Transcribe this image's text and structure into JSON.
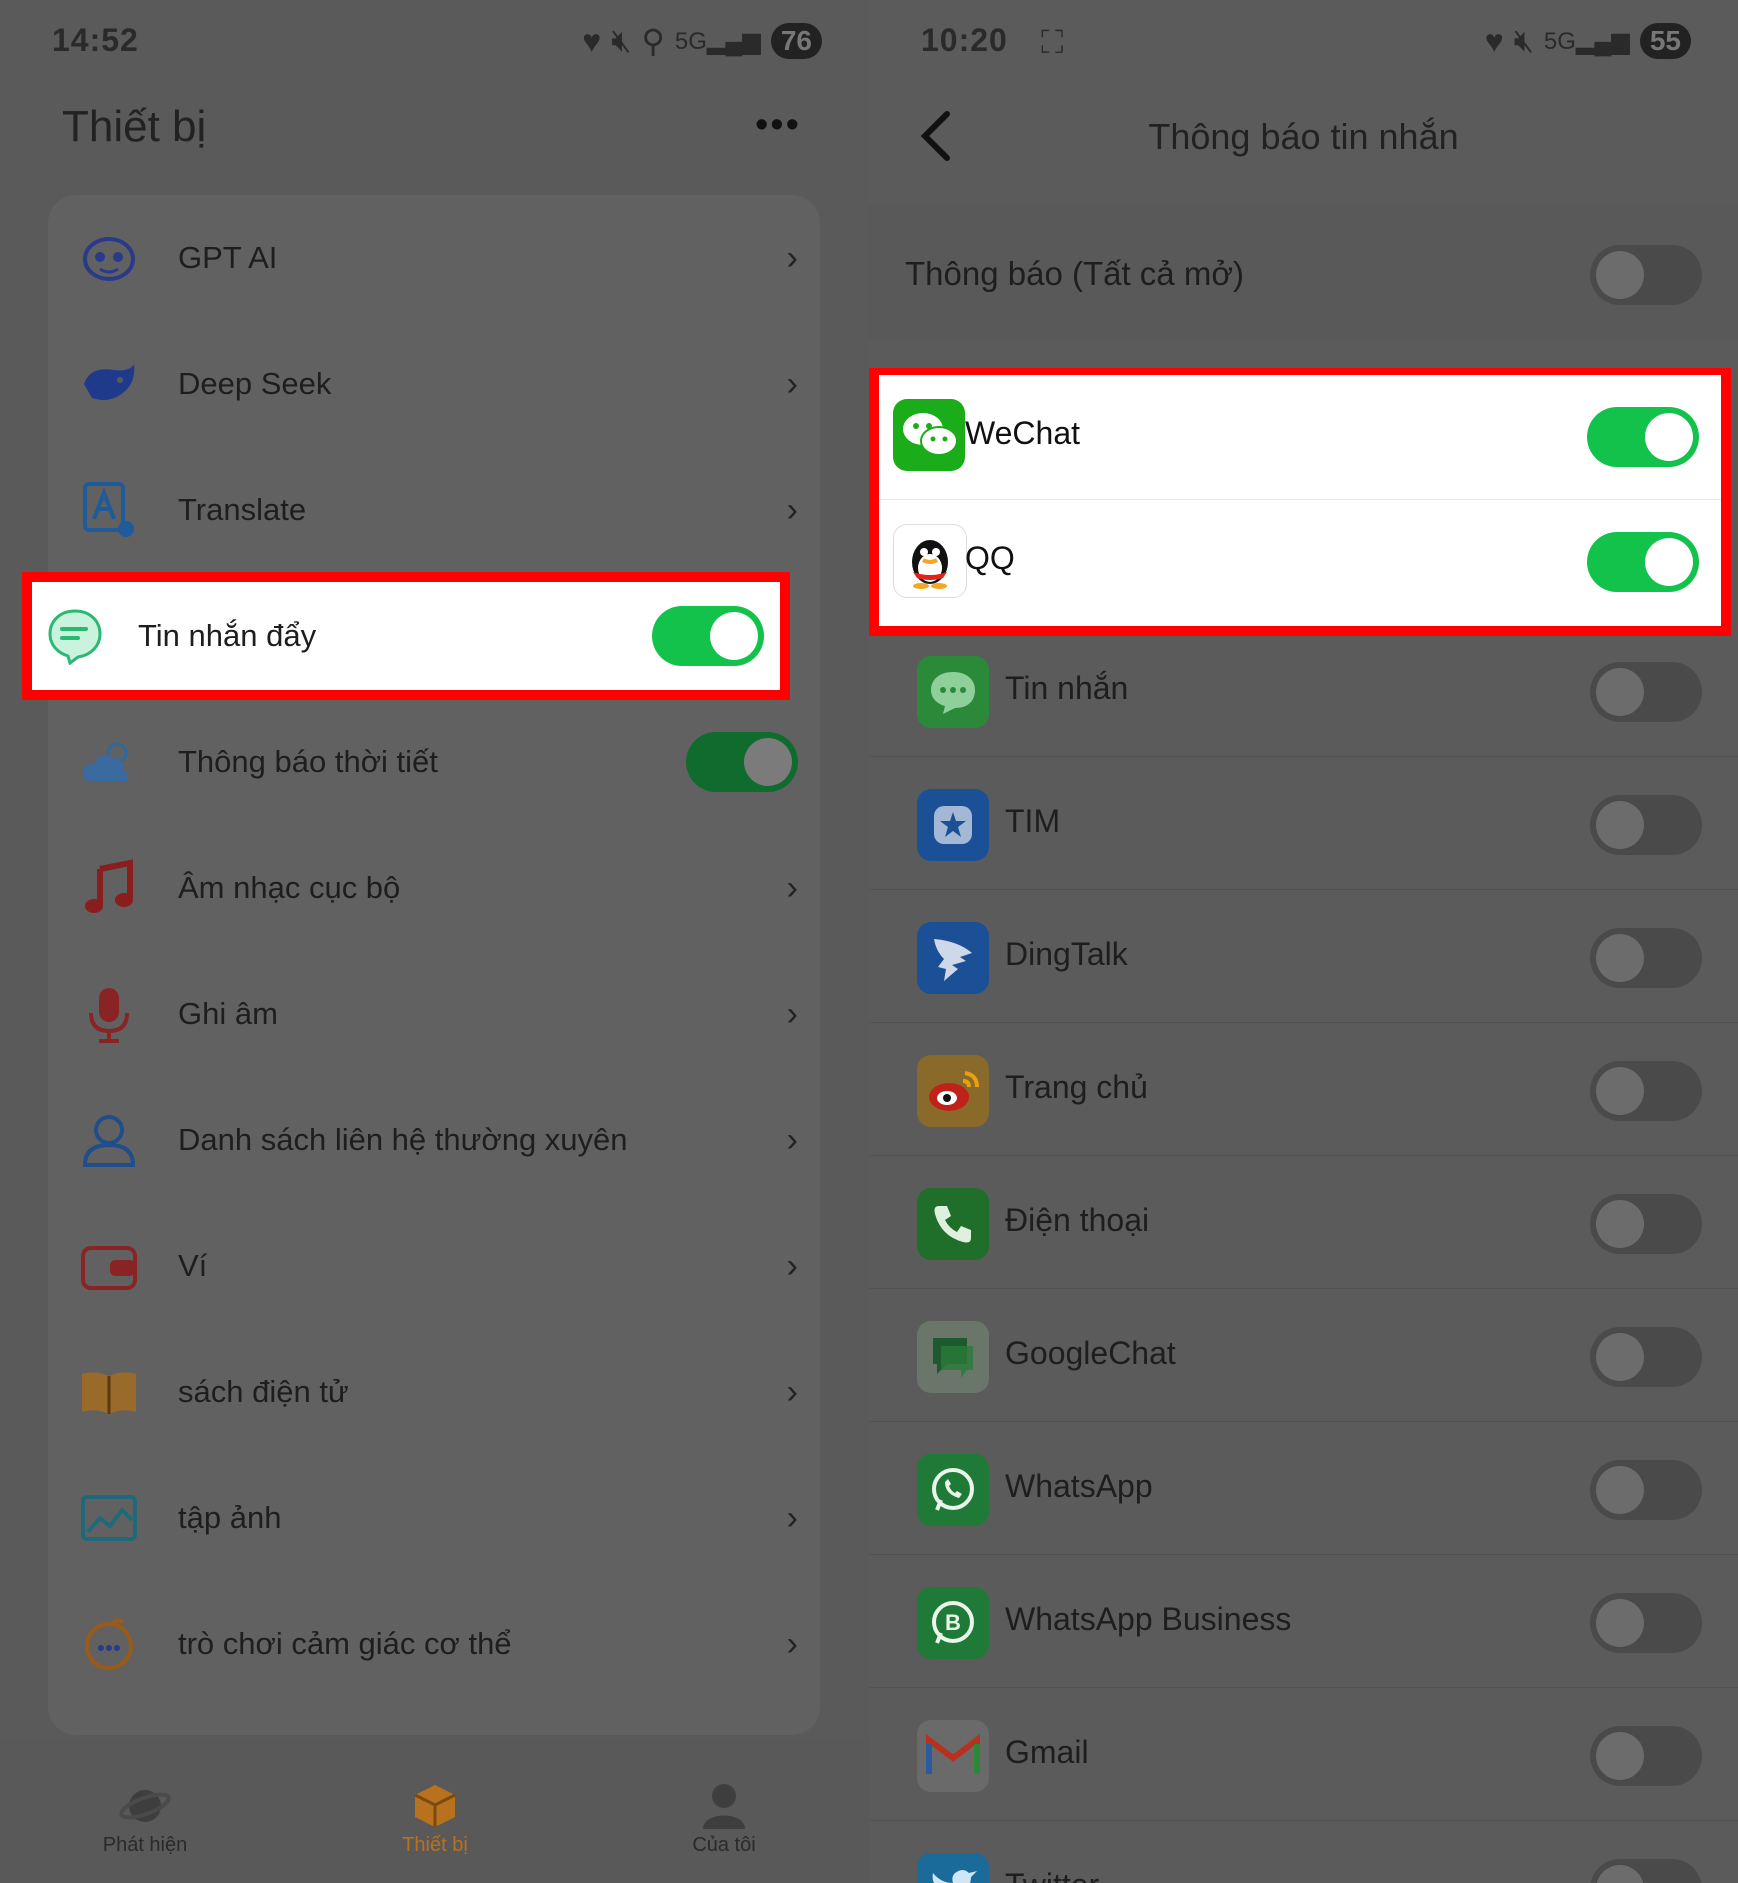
{
  "left": {
    "status": {
      "time": "14:52",
      "battery": "76"
    },
    "title": "Thiết bị",
    "more_label": "•••",
    "items": [
      {
        "label": "GPT AI",
        "icon": "robot-icon"
      },
      {
        "label": "Deep Seek",
        "icon": "whale-icon"
      },
      {
        "label": "Translate",
        "icon": "translate-icon"
      },
      {
        "label": "Tin nhắn đẩy",
        "icon": "chat-bubble-icon",
        "toggle": "on",
        "highlighted": true
      },
      {
        "label": "Thông báo thời tiết",
        "icon": "weather-icon",
        "toggle": "on"
      },
      {
        "label": "Âm nhạc cục bộ",
        "icon": "music-note-icon"
      },
      {
        "label": "Ghi âm",
        "icon": "microphone-icon"
      },
      {
        "label": "Danh sách liên hệ thường xuyên",
        "icon": "contact-icon"
      },
      {
        "label": "Ví",
        "icon": "wallet-icon"
      },
      {
        "label": "sách điện tử",
        "icon": "book-icon"
      },
      {
        "label": "tập ảnh",
        "icon": "photo-album-icon"
      },
      {
        "label": "trò chơi cảm giác cơ thể",
        "icon": "game-icon"
      }
    ],
    "nav": [
      {
        "label": "Phát hiện",
        "icon": "planet-icon"
      },
      {
        "label": "Thiết bị",
        "icon": "device-box-icon",
        "active": true
      },
      {
        "label": "Của tôi",
        "icon": "profile-icon"
      }
    ]
  },
  "right": {
    "status": {
      "time": "10:20",
      "battery": "55"
    },
    "title": "Thông báo tin nhắn",
    "all_toggle": {
      "label": "Thông báo (Tất cả mở)",
      "state": "off"
    },
    "apps": [
      {
        "label": "WeChat",
        "state": "on",
        "highlighted": true,
        "color": "#1aad19"
      },
      {
        "label": "QQ",
        "state": "on",
        "highlighted": true,
        "color": "#ffffff"
      },
      {
        "label": "Tin nhắn",
        "state": "off",
        "color": "#2a8a3a"
      },
      {
        "label": "TIM",
        "state": "off",
        "color": "#1b4f96"
      },
      {
        "label": "DingTalk",
        "state": "off",
        "color": "#1b4f96"
      },
      {
        "label": "Trang chủ",
        "state": "off",
        "color": "#8a6a2a"
      },
      {
        "label": "Điện thoại",
        "state": "off",
        "color": "#1f6e2a"
      },
      {
        "label": "GoogleChat",
        "state": "off",
        "color": "#6a766a"
      },
      {
        "label": "WhatsApp",
        "state": "off",
        "color": "#1f7a38"
      },
      {
        "label": "WhatsApp Business",
        "state": "off",
        "color": "#1f7a38"
      },
      {
        "label": "Gmail",
        "state": "off",
        "color": "#6a6a6a"
      },
      {
        "label": "Twitter",
        "state": "off",
        "color": "#1a6b9a"
      }
    ]
  },
  "colors": {
    "accent_green": "#12c24a",
    "highlight_red": "#ff0000",
    "active_nav": "#b8721e"
  }
}
